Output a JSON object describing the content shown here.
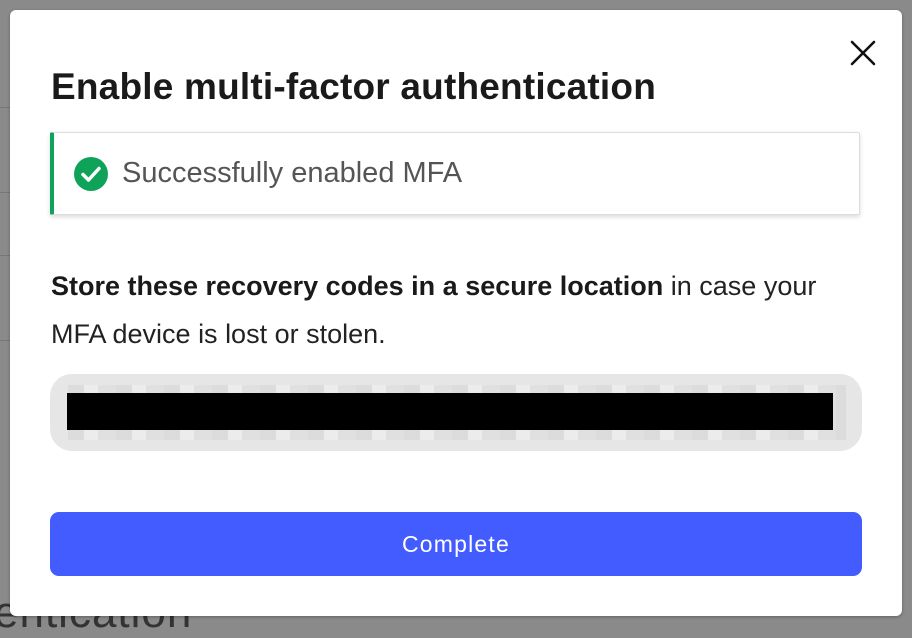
{
  "background": {
    "partial_text": "entication"
  },
  "dialog": {
    "title": "Enable multi-factor authentication",
    "close_icon": "close-icon",
    "alert": {
      "icon": "check-circle-icon",
      "message": "Successfully enabled MFA",
      "color": "#0fa35a"
    },
    "description_bold": "Store these recovery codes in a secure location",
    "description_rest": " in case your MFA device is lost or stolen.",
    "recovery_codes_redacted": true,
    "complete_label": "Complete",
    "accent_color": "#425cff"
  }
}
